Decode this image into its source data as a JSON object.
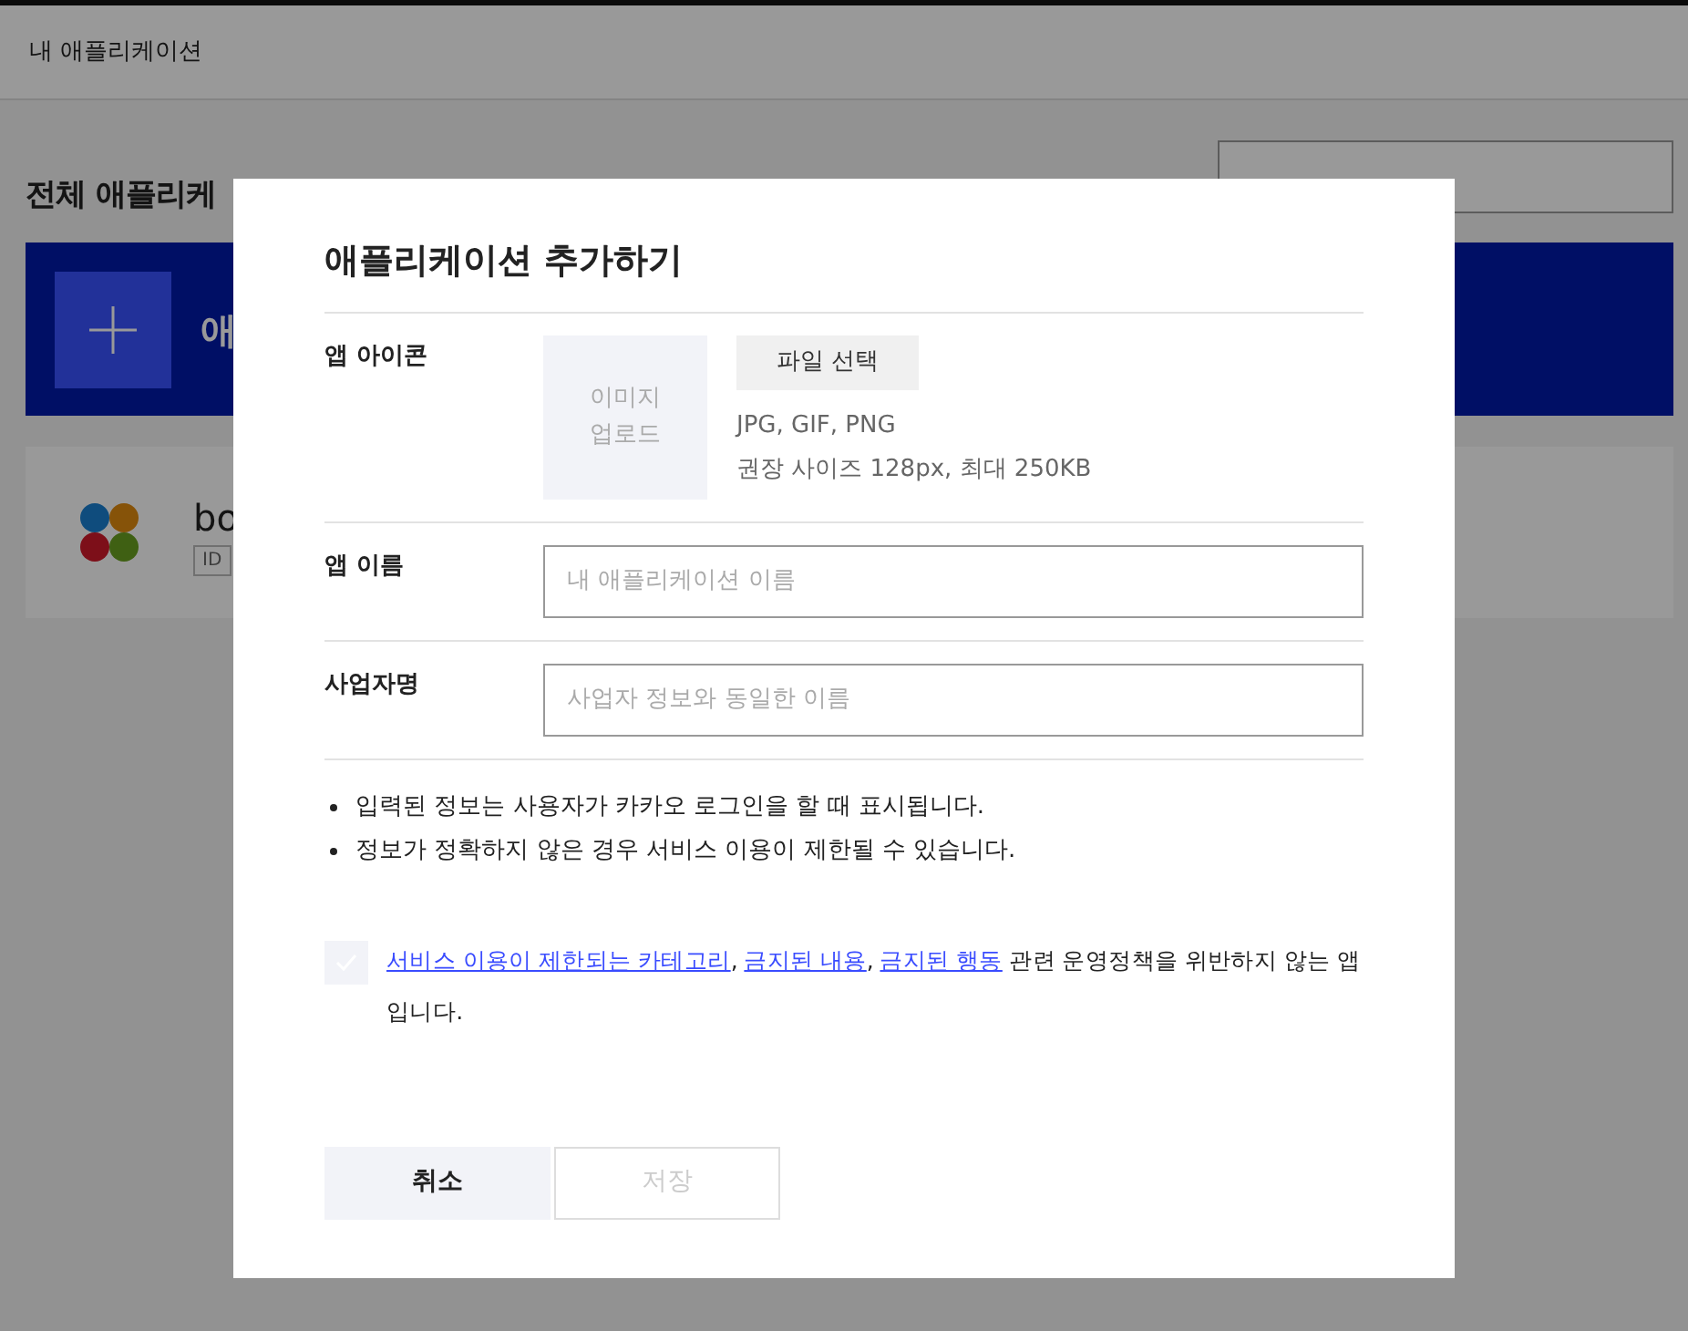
{
  "header": {
    "title": "내 애플리케이션"
  },
  "page": {
    "heading": "전체 애플리케",
    "add_banner": {
      "label": "애"
    },
    "apps": [
      {
        "name": "bo",
        "tag": "ID"
      }
    ]
  },
  "modal": {
    "title": "애플리케이션 추가하기",
    "icon_row": {
      "label": "앱 아이콘",
      "upload_lines": [
        "이미지",
        "업로드"
      ],
      "file_button": "파일 선택",
      "hints": [
        "JPG, GIF, PNG",
        "권장 사이즈 128px, 최대 250KB"
      ]
    },
    "fields": [
      {
        "label": "앱 이름",
        "placeholder": "내 애플리케이션 이름"
      },
      {
        "label": "사업자명",
        "placeholder": "사업자 정보와 동일한 이름"
      }
    ],
    "notes": [
      "입력된 정보는 사용자가 카카오 로그인을 할 때 표시됩니다.",
      "정보가 정확하지 않은 경우 서비스 이용이 제한될 수 있습니다."
    ],
    "agreement": {
      "checked": false,
      "parts": [
        {
          "kind": "link",
          "text": "서비스 이용이 제한되는 카테고리"
        },
        {
          "kind": "text",
          "text": ", "
        },
        {
          "kind": "link",
          "text": "금지된 내용"
        },
        {
          "kind": "text",
          "text": ", "
        },
        {
          "kind": "link",
          "text": "금지된 행동"
        },
        {
          "kind": "text",
          "text": " 관련 운영정책을 위반하지 않는 앱 입니다."
        }
      ]
    },
    "buttons": [
      {
        "label": "취소",
        "kind": "cancel",
        "disabled": false
      },
      {
        "label": "저장",
        "kind": "save",
        "disabled": true
      }
    ]
  }
}
